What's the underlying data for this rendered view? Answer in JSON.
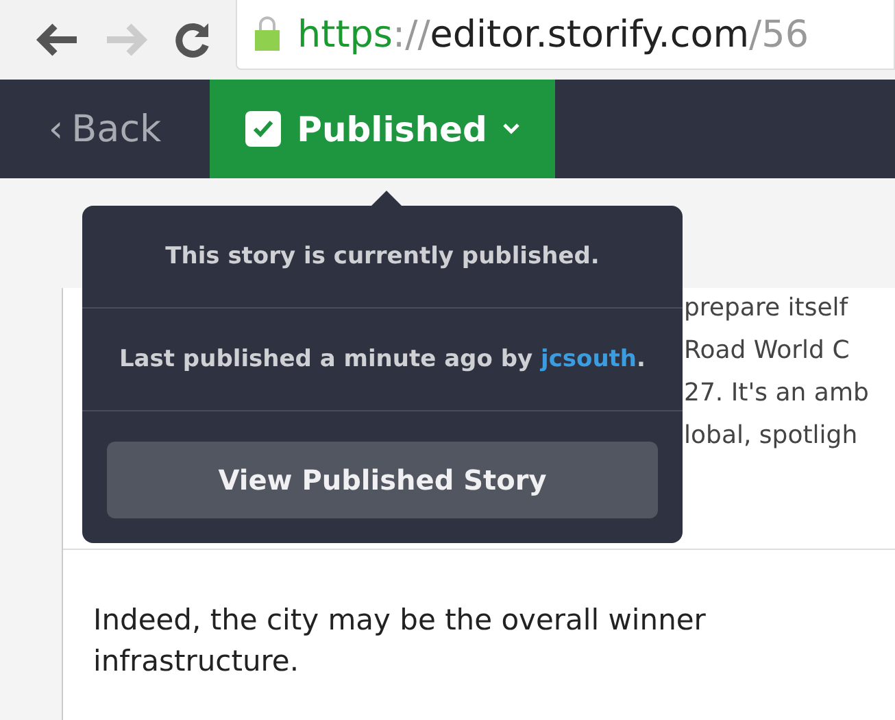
{
  "browser": {
    "url": {
      "scheme": "https",
      "separator": "://",
      "host": "editor.storify.com",
      "path": "/56"
    }
  },
  "app_bar": {
    "back": {
      "icon": "‹",
      "label": "Back"
    },
    "status": {
      "label": "Published",
      "checked": true
    }
  },
  "story": {
    "lines_right": [
      "prepare itself",
      "Road World C",
      "27. It's an amb",
      "lobal, spotligh"
    ],
    "paragraph": [
      "Indeed, the city may be the overall winner",
      "infrastructure."
    ]
  },
  "popover": {
    "status_text": "This story is currently published.",
    "last_published": "Last published a minute ago by",
    "author": "jcsouth",
    "author_suffix": ".",
    "button": "View Published Story"
  }
}
